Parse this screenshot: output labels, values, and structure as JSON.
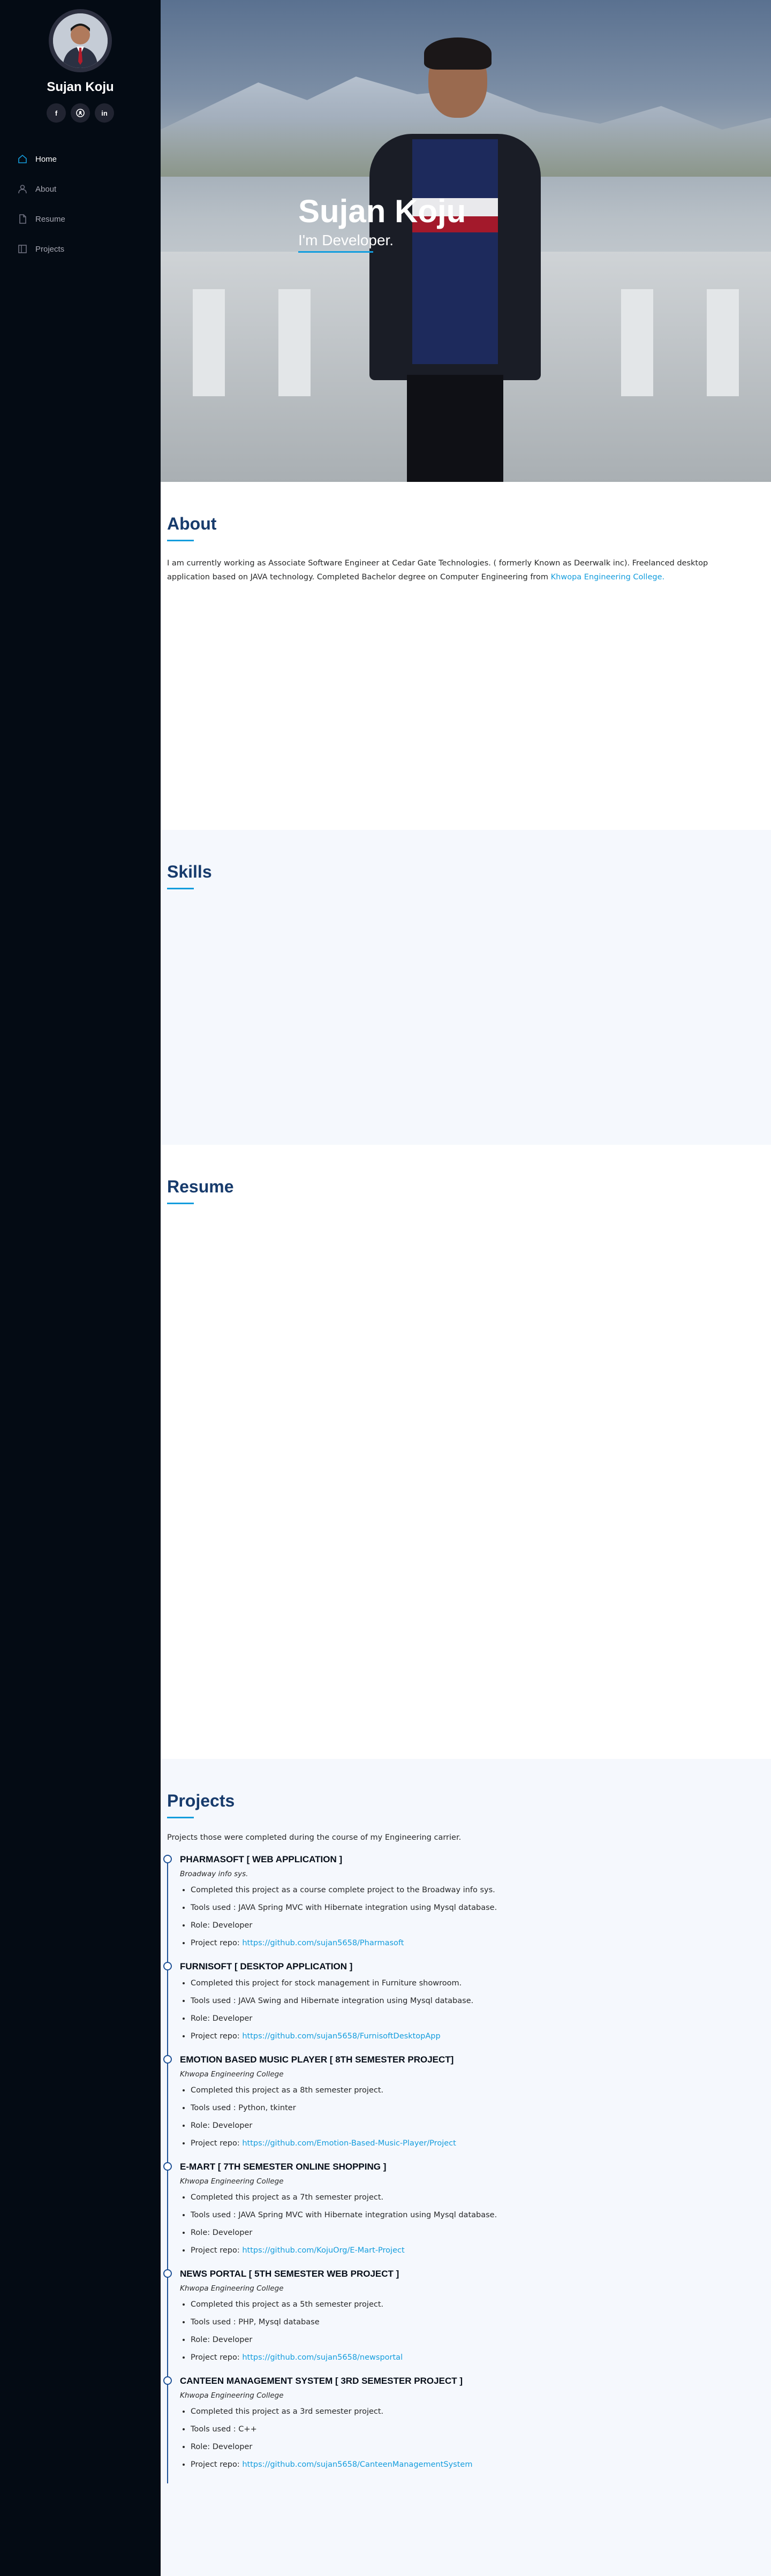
{
  "sidebar": {
    "name": "Sujan Koju",
    "social": [
      {
        "icon": "facebook-icon",
        "glyph": "f"
      },
      {
        "icon": "github-icon",
        "glyph": "◎"
      },
      {
        "icon": "linkedin-icon",
        "glyph": "in"
      }
    ],
    "nav": [
      {
        "label": "Home",
        "icon": "home-icon",
        "active": true
      },
      {
        "label": "About",
        "icon": "person-icon",
        "active": false
      },
      {
        "label": "Resume",
        "icon": "file-icon",
        "active": false
      },
      {
        "label": "Projects",
        "icon": "book-icon",
        "active": false
      }
    ]
  },
  "hero": {
    "name": "Sujan Koju",
    "role": "I'm Developer."
  },
  "about": {
    "title": "About",
    "text": "I am currently working as Associate Software Engineer at Cedar Gate Technologies. ( formerly Known as Deerwalk inc). Freelanced desktop application based on JAVA technology. Completed Bachelor degree on Computer Engineering from ",
    "link": "Khwopa Engineering College."
  },
  "skills": {
    "title": "Skills"
  },
  "resume": {
    "title": "Resume"
  },
  "projects": {
    "title": "Projects",
    "intro": "Projects those were completed during the course of my Engineering carrier.",
    "items": [
      {
        "title": "PHARMASOFT [ WEB APPLICATION ]",
        "sub": "Broadway info sys.",
        "bullets": [
          "Completed this project as a course complete project to the Broadway info sys.",
          "Tools used : JAVA Spring MVC with Hibernate integration using Mysql database.",
          "Role: Developer"
        ],
        "repo_label": "Project repo: ",
        "repo": "https://github.com/sujan5658/Pharmasoft"
      },
      {
        "title": "FURNISOFT [ DESKTOP APPLICATION ]",
        "sub": "",
        "bullets": [
          "Completed this project for stock management in Furniture showroom.",
          "Tools used : JAVA Swing and Hibernate integration using Mysql database.",
          "Role: Developer"
        ],
        "repo_label": "Project repo: ",
        "repo": "https://github.com/sujan5658/FurnisoftDesktopApp"
      },
      {
        "title": "EMOTION BASED MUSIC PLAYER [ 8TH SEMESTER PROJECT]",
        "sub": "Khwopa Engineering College",
        "bullets": [
          "Completed this project as a 8th semester project.",
          "Tools used : Python, tkinter",
          "Role: Developer"
        ],
        "repo_label": "Project repo: ",
        "repo": "https://github.com/Emotion-Based-Music-Player/Project"
      },
      {
        "title": "E-MART [ 7TH SEMESTER ONLINE SHOPPING ]",
        "sub": "Khwopa Engineering College",
        "bullets": [
          "Completed this project as a 7th semester project.",
          "Tools used : JAVA Spring MVC with Hibernate integration using Mysql database.",
          "Role: Developer"
        ],
        "repo_label": "Project repo: ",
        "repo": "https://github.com/KojuOrg/E-Mart-Project"
      },
      {
        "title": "NEWS PORTAL [ 5TH SEMESTER WEB PROJECT ]",
        "sub": "Khwopa Engineering College",
        "bullets": [
          "Completed this project as a 5th semester project.",
          "Tools used : PHP, Mysql database",
          "Role: Developer"
        ],
        "repo_label": "Project repo: ",
        "repo": "https://github.com/sujan5658/newsportal"
      },
      {
        "title": "CANTEEN MANAGEMENT SYSTEM [ 3RD SEMESTER PROJECT ]",
        "sub": "Khwopa Engineering College",
        "bullets": [
          "Completed this project as a 3rd semester project.",
          "Tools used : C++",
          "Role: Developer"
        ],
        "repo_label": "Project repo: ",
        "repo": "https://github.com/sujan5658/CanteenManagementSystem"
      }
    ]
  },
  "colors": {
    "sidebar_bg": "#040b14",
    "accent": "#149ddd",
    "heading": "#173b6c",
    "alt_section_bg": "#f5f8fd"
  }
}
